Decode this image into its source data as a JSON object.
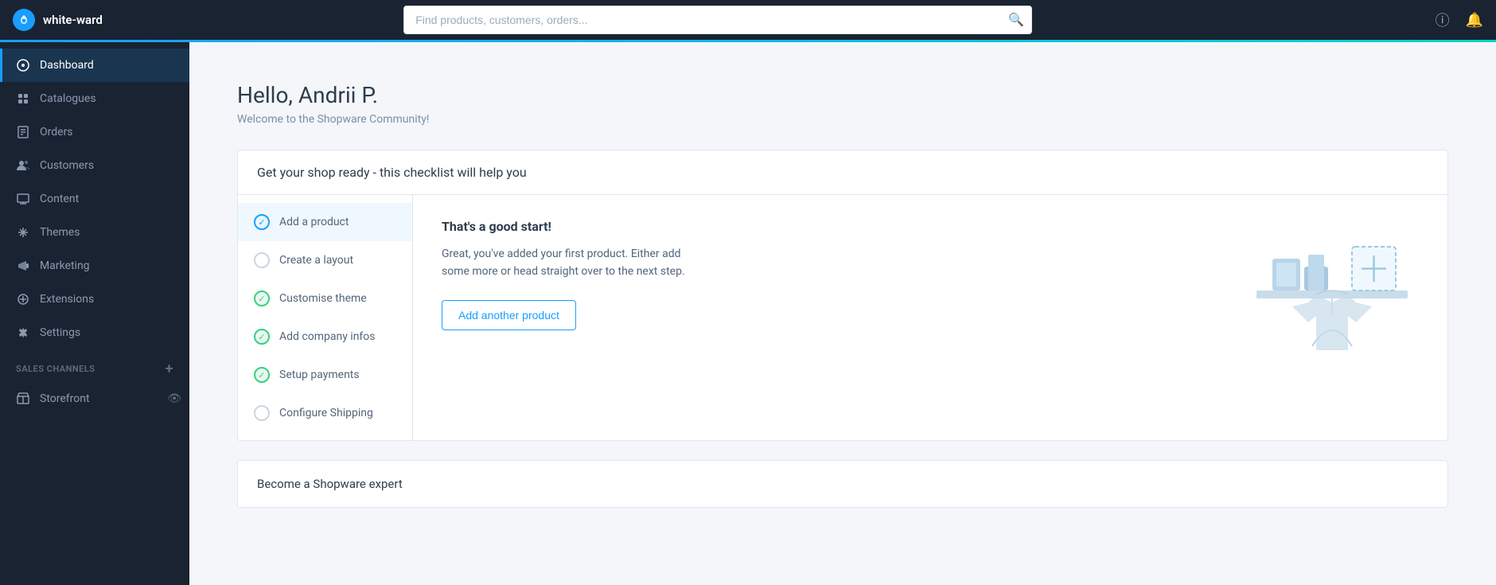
{
  "app": {
    "name": "white-ward"
  },
  "topbar": {
    "search_placeholder": "Find products, customers, orders..."
  },
  "sidebar": {
    "nav_items": [
      {
        "id": "dashboard",
        "label": "Dashboard",
        "active": true,
        "icon": "dashboard-icon"
      },
      {
        "id": "catalogues",
        "label": "Catalogues",
        "active": false,
        "icon": "catalogues-icon"
      },
      {
        "id": "orders",
        "label": "Orders",
        "active": false,
        "icon": "orders-icon"
      },
      {
        "id": "customers",
        "label": "Customers",
        "active": false,
        "icon": "customers-icon"
      },
      {
        "id": "content",
        "label": "Content",
        "active": false,
        "icon": "content-icon"
      },
      {
        "id": "themes",
        "label": "Themes",
        "active": false,
        "icon": "themes-icon"
      },
      {
        "id": "marketing",
        "label": "Marketing",
        "active": false,
        "icon": "marketing-icon"
      },
      {
        "id": "extensions",
        "label": "Extensions",
        "active": false,
        "icon": "extensions-icon"
      },
      {
        "id": "settings",
        "label": "Settings",
        "active": false,
        "icon": "settings-icon"
      }
    ],
    "sales_channels_label": "Sales Channels",
    "storefront_label": "Storefront"
  },
  "main": {
    "greeting": "Hello, Andrii P.",
    "subtitle": "Welcome to the Shopware Community!",
    "checklist": {
      "header": "Get your shop ready - this checklist will help you",
      "items": [
        {
          "id": "add-product",
          "label": "Add a product",
          "status": "done-blue"
        },
        {
          "id": "create-layout",
          "label": "Create a layout",
          "status": "empty"
        },
        {
          "id": "customise-theme",
          "label": "Customise theme",
          "status": "done-green"
        },
        {
          "id": "add-company-infos",
          "label": "Add company infos",
          "status": "done-green"
        },
        {
          "id": "setup-payments",
          "label": "Setup payments",
          "status": "done-green"
        },
        {
          "id": "configure-shipping",
          "label": "Configure Shipping",
          "status": "empty"
        }
      ],
      "detail_title": "That's a good start!",
      "detail_desc": "Great, you've added your first product. Either add some more or head straight over to the next step.",
      "action_button": "Add another product"
    },
    "bottom_card_text": "Become a Shopware expert"
  }
}
